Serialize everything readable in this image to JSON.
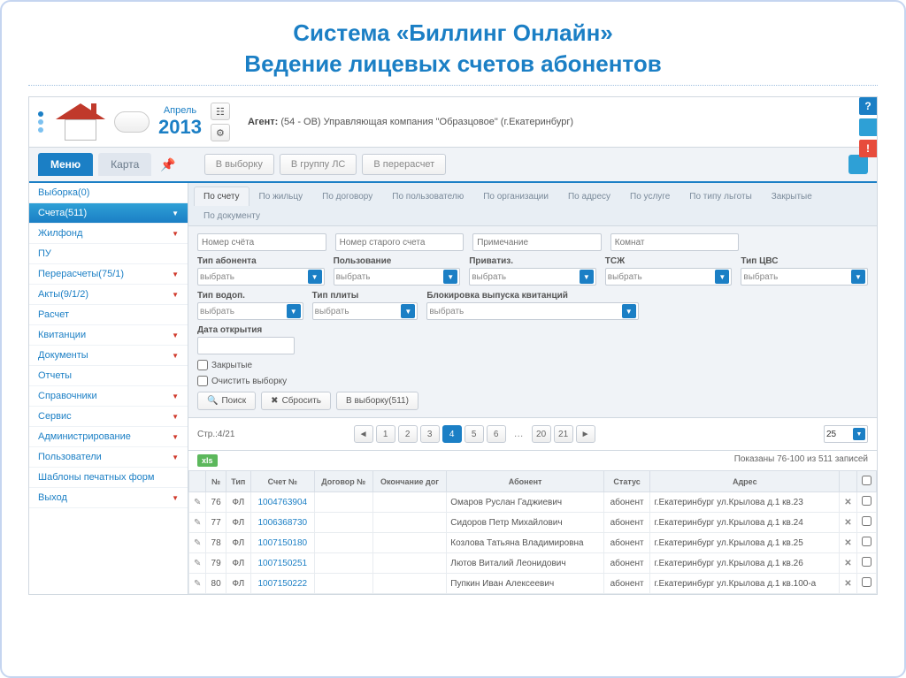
{
  "page": {
    "title": "Система «Биллинг Онлайн»",
    "subtitle": "Ведение лицевых счетов абонентов"
  },
  "header": {
    "month": "Апрель",
    "year": "2013",
    "agent_label": "Агент:",
    "agent_value": "(54 - ОВ) Управляющая компания \"Образцовое\" (г.Екатеринбург)"
  },
  "tabs": {
    "menu": "Меню",
    "map": "Карта"
  },
  "toolbar": {
    "to_selection": "В выборку",
    "to_group": "В группу ЛС",
    "to_recalc": "В перерасчет"
  },
  "sidebar": [
    {
      "label": "Выборка(0)",
      "expand": false,
      "active": false
    },
    {
      "label": "Счета(511)",
      "expand": true,
      "active": true
    },
    {
      "label": "Жилфонд",
      "expand": true,
      "active": false
    },
    {
      "label": "ПУ",
      "expand": false,
      "active": false
    },
    {
      "label": "Перерасчеты(75/1)",
      "expand": true,
      "active": false
    },
    {
      "label": "Акты(9/1/2)",
      "expand": true,
      "active": false
    },
    {
      "label": "Расчет",
      "expand": false,
      "active": false
    },
    {
      "label": "Квитанции",
      "expand": true,
      "active": false
    },
    {
      "label": "Документы",
      "expand": true,
      "active": false
    },
    {
      "label": "Отчеты",
      "expand": false,
      "active": false
    },
    {
      "label": "Справочники",
      "expand": true,
      "active": false
    },
    {
      "label": "Сервис",
      "expand": true,
      "active": false
    },
    {
      "label": "Администрирование",
      "expand": true,
      "active": false
    },
    {
      "label": "Пользователи",
      "expand": true,
      "active": false
    },
    {
      "label": "Шаблоны печатных форм",
      "expand": false,
      "active": false
    },
    {
      "label": "Выход",
      "expand": true,
      "active": false
    }
  ],
  "filter_tabs_row1": [
    "По счету",
    "По жильцу",
    "По договору",
    "По пользователю",
    "По организации",
    "По адресу",
    "По услуге",
    "По типу льготы"
  ],
  "filter_tabs_row2": [
    "Закрытые",
    "По документу"
  ],
  "filter_tabs_active": "По счету",
  "filter_text_inputs": {
    "account_no": "Номер счёта",
    "old_account": "Номер старого счета",
    "note": "Примечание",
    "room": "Комнат"
  },
  "filter_selects_row1": [
    {
      "label": "Тип абонента",
      "value": "выбрать"
    },
    {
      "label": "Пользование",
      "value": "выбрать"
    },
    {
      "label": "Приватиз.",
      "value": "выбрать"
    },
    {
      "label": "ТСЖ",
      "value": "выбрать"
    },
    {
      "label": "Тип ЦВС",
      "value": "выбрать"
    }
  ],
  "filter_selects_row2": [
    {
      "label": "Тип водоп.",
      "value": "выбрать"
    },
    {
      "label": "Тип плиты",
      "value": "выбрать"
    },
    {
      "label": "Блокировка выпуска квитанций",
      "value": "выбрать",
      "wide": true
    }
  ],
  "filter_date_label": "Дата открытия",
  "filter_closed_checkbox": "Закрытые",
  "filter_clear_checkbox": "Очистить выборку",
  "filter_buttons": {
    "search": "Поиск",
    "reset": "Сбросить",
    "to_selection": "В выборку(511)"
  },
  "pager": {
    "left_info": "Стр.:4/21",
    "pages": [
      "1",
      "2",
      "3",
      "4",
      "5",
      "6"
    ],
    "skip_pages": [
      "20",
      "21"
    ],
    "active": "4",
    "page_size": "25",
    "summary": "Показаны 76-100 из 511 записей"
  },
  "xls": "xls",
  "table": {
    "headers": [
      "",
      "№",
      "Тип",
      "Счет №",
      "Договор №",
      "Окончание дог",
      "Абонент",
      "Статус",
      "Адрес",
      "",
      ""
    ],
    "rows": [
      {
        "n": "76",
        "type": "ФЛ",
        "acct": "1004763904",
        "contract": "",
        "end": "",
        "sub": "Омаров Руслан Гаджиевич",
        "status": "абонент",
        "addr": "г.Екатеринбург ул.Крылова д.1 кв.23"
      },
      {
        "n": "77",
        "type": "ФЛ",
        "acct": "1006368730",
        "contract": "",
        "end": "",
        "sub": "Сидоров Петр Михайлович",
        "status": "абонент",
        "addr": "г.Екатеринбург ул.Крылова д.1 кв.24"
      },
      {
        "n": "78",
        "type": "ФЛ",
        "acct": "1007150180",
        "contract": "",
        "end": "",
        "sub": "Козлова Татьяна Владимировна",
        "status": "абонент",
        "addr": "г.Екатеринбург ул.Крылова д.1 кв.25"
      },
      {
        "n": "79",
        "type": "ФЛ",
        "acct": "1007150251",
        "contract": "",
        "end": "",
        "sub": "Лютов Виталий Леонидович",
        "status": "абонент",
        "addr": "г.Екатеринбург ул.Крылова д.1 кв.26"
      },
      {
        "n": "80",
        "type": "ФЛ",
        "acct": "1007150222",
        "contract": "",
        "end": "",
        "sub": "Пупкин Иван Алексеевич",
        "status": "абонент",
        "addr": "г.Екатеринбург ул.Крылова д.1 кв.100-а"
      }
    ]
  }
}
